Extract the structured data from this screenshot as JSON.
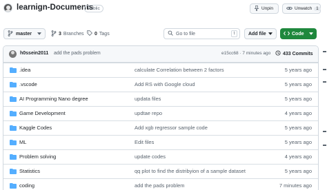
{
  "repo": {
    "name": "learnign-Documents",
    "visibility": "Public"
  },
  "actions": {
    "unpin_label": "Unpin",
    "unwatch_label": "Unwatch",
    "unwatch_count": "1"
  },
  "toolbar": {
    "branch": "master",
    "branches_count": "3",
    "branches_label": "Branches",
    "tags_count": "0",
    "tags_label": "Tags",
    "goto_placeholder": "Go to file",
    "goto_kbd": "t",
    "add_file_label": "Add file",
    "code_label": "Code"
  },
  "latest_commit": {
    "author": "h0ssein2011",
    "message": "add the pads problem",
    "hash_time": "e15cc68 · 7 minutes ago",
    "commits_label": "433 Commits"
  },
  "files": [
    {
      "name": ".idea",
      "message": "calculate Correlation between 2 factors",
      "time": "5 years ago"
    },
    {
      "name": ".vscode",
      "message": "Add RS with Google cloud",
      "time": "5 years ago"
    },
    {
      "name": "AI Programming Nano degree",
      "message": "updata files",
      "time": "5 years ago"
    },
    {
      "name": "Game Development",
      "message": "updtae repo",
      "time": "4 years ago"
    },
    {
      "name": "Kaggle Codes",
      "message": "Add xgb regressor sample code",
      "time": "5 years ago"
    },
    {
      "name": "ML",
      "message": "Edit files",
      "time": "5 years ago"
    },
    {
      "name": "Problem solving",
      "message": "update codes",
      "time": "4 years ago"
    },
    {
      "name": "Statistics",
      "message": "qq plot to find the distribyion of a sample dataset",
      "time": "5 years ago"
    },
    {
      "name": "coding",
      "message": "add the pads problem",
      "time": "7 minutes ago"
    }
  ],
  "colors": {
    "folder": "#54aeff",
    "primary_green": "#1f883d",
    "border": "#d0d7de",
    "muted_text": "#59636e"
  }
}
